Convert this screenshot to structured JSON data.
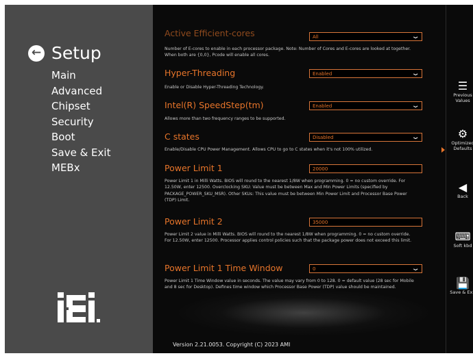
{
  "nav": {
    "title": "Setup",
    "items": [
      "Main",
      "Advanced",
      "Chipset",
      "Security",
      "Boot",
      "Save & Exit",
      "MEBx"
    ]
  },
  "logo": {
    "text": "iEi"
  },
  "settings": {
    "partial": {
      "label": "Active Efficient-cores",
      "value": "All"
    },
    "ecores_help": "Number of E-cores to enable in each processor package. Note: Number of Cores and E-cores are looked at together. When both are {0,0}, Pcode will enable all cores.",
    "items": [
      {
        "label": "Hyper-Threading",
        "value": "Enabled",
        "help": "Enable or Disable Hyper-Threading Technology."
      },
      {
        "label": "Intel(R) SpeedStep(tm)",
        "value": "Enabled",
        "help": "Allows more than two frequency ranges to be supported."
      },
      {
        "label": "C states",
        "value": "Disabled",
        "help": "Enable/Disable CPU Power Management. Allows CPU to go to C states when it's not 100% utilized."
      },
      {
        "label": "Power Limit 1",
        "value": "20000",
        "help": "Power Limit 1 in Milli Watts. BIOS will round to the nearest 1/8W when programming. 0 = no custom override. For 12.50W, enter 12500. Overclocking SKU: Value must be between Max and Min Power Limits (specified by PACKAGE_POWER_SKU_MSR). Other SKUs: This value must be between Min Power Limit and Processor Base Power (TDP) Limit."
      },
      {
        "label": "Power Limit 2",
        "value": "35000",
        "help": "Power Limit 2 value in Milli Watts. BIOS will round to the nearest 1/8W when programming. 0 = no custom override. For 12.50W, enter 12500. Processor applies control policies such that the package power does not exceed this limit."
      },
      {
        "label": "Power Limit 1 Time Window",
        "value": "0",
        "help": "Power Limit 1 Time Window value in seconds. The value may vary from 0 to 128. 0 = default value (28 sec for Mobile and 8 sec for Desktop). Defines time window which Processor Base Power (TDP) value should be maintained."
      }
    ]
  },
  "footer": {
    "version": "Version 2.21.0053. Copyright (C) 2023 AMI"
  },
  "sidebar": {
    "previous_values": "Previous Values",
    "optimized_defaults": "Optimized Defaults",
    "back": "Back",
    "soft_kbd": "Soft kbd",
    "save_exit": "Save & Exit"
  },
  "colors": {
    "accent": "#e8752a",
    "nav_bg": "#4a4a4a",
    "main_bg": "#0a0a0a"
  }
}
